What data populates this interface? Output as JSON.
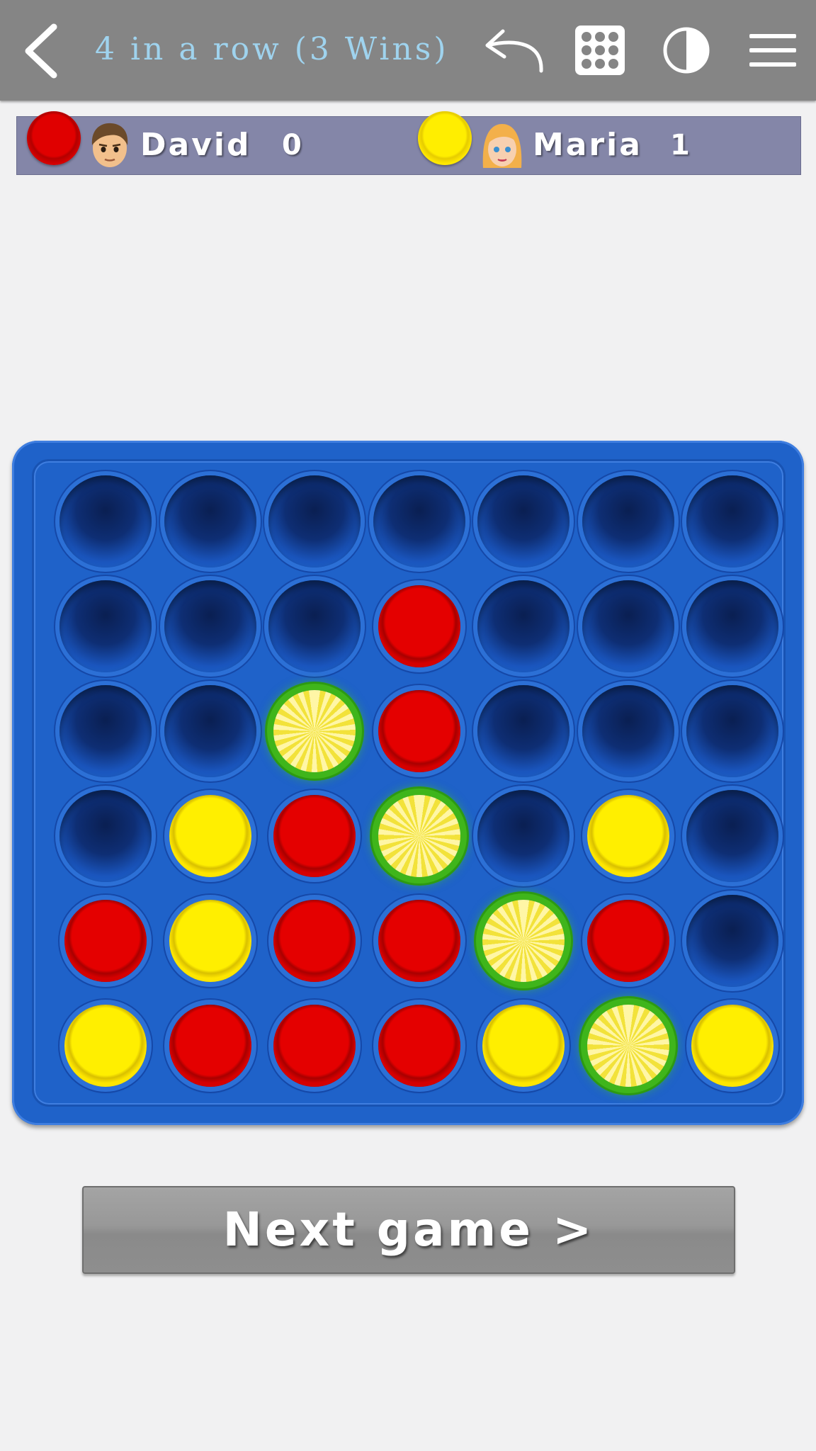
{
  "header": {
    "title": "4 in a row (3 Wins)",
    "icons": [
      "back-arrow-icon",
      "undo-icon",
      "grid-icon",
      "contrast-icon",
      "menu-icon"
    ]
  },
  "players": [
    {
      "name": "David",
      "score": "0",
      "chip_color": "red",
      "avatar": "boy-face"
    },
    {
      "name": "Maria",
      "score": "1",
      "chip_color": "yellow",
      "avatar": "girl-face"
    }
  ],
  "board": {
    "columns": 7,
    "rows": 6,
    "grid": [
      [
        "empty",
        "empty",
        "empty",
        "empty",
        "empty",
        "empty",
        "empty"
      ],
      [
        "empty",
        "empty",
        "empty",
        "red",
        "empty",
        "empty",
        "empty"
      ],
      [
        "empty",
        "empty",
        "yellow-win",
        "red",
        "empty",
        "empty",
        "empty"
      ],
      [
        "empty",
        "yellow",
        "red",
        "yellow-win",
        "empty",
        "yellow",
        "empty"
      ],
      [
        "red",
        "yellow",
        "red",
        "red",
        "yellow-win",
        "red",
        "empty"
      ],
      [
        "yellow",
        "red",
        "red",
        "red",
        "yellow",
        "yellow-win",
        "yellow"
      ]
    ]
  },
  "colors": {
    "header_bg": "#858585",
    "title_text": "#9fd3ee",
    "scorebar_bg": "#8486a8",
    "board_blue": "#1f62c9",
    "red_chip": "#e00000",
    "yellow_chip": "#ffee00",
    "win_glow": "#3fb51b"
  },
  "actions": {
    "next_game_label": "Next game >"
  }
}
